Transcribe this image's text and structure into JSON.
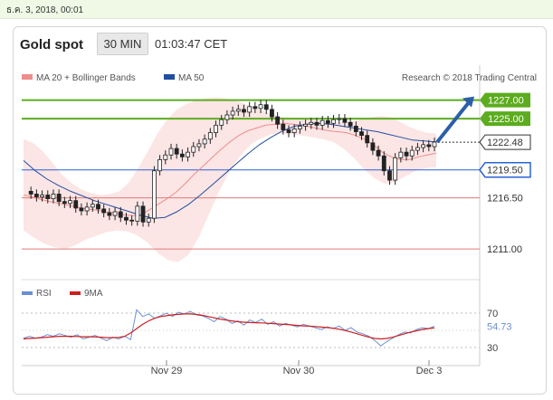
{
  "header": {
    "datetime": "ธ.ค. 3, 2018, 00:01",
    "title": "Gold spot",
    "timeframe": "30 MIN",
    "clock": "01:03:47 CET"
  },
  "chart_data": [
    {
      "type": "line",
      "title": "Gold spot",
      "legend": [
        {
          "name": "MA 20 + Bollinger Bands",
          "color": "#f08c8c"
        },
        {
          "name": "MA 50",
          "color": "#1f4fa0"
        }
      ],
      "credit": "Research © 2018 Trading Central",
      "x_ticks": [
        "Nov 29",
        "Nov 30",
        "Dec 3"
      ],
      "ylim": [
        1208,
        1229
      ],
      "price": [
        1217.2,
        1216.9,
        1216.6,
        1216.8,
        1216.4,
        1216.9,
        1216.1,
        1215.9,
        1216.2,
        1215.4,
        1215.1,
        1215.5,
        1215.8,
        1215.3,
        1214.9,
        1214.6,
        1215.0,
        1214.4,
        1214.1,
        1214.0,
        1215.6,
        1213.9,
        1214.3,
        1219.4,
        1220.6,
        1221.1,
        1221.8,
        1221.2,
        1220.9,
        1221.4,
        1222.0,
        1222.3,
        1222.8,
        1223.5,
        1224.3,
        1224.9,
        1225.4,
        1225.8,
        1226.0,
        1225.7,
        1226.3,
        1226.1,
        1226.5,
        1226.0,
        1225.2,
        1224.4,
        1223.8,
        1223.5,
        1223.9,
        1224.2,
        1224.4,
        1224.6,
        1224.3,
        1224.8,
        1224.5,
        1224.9,
        1225.0,
        1224.6,
        1224.2,
        1223.6,
        1223.2,
        1222.4,
        1221.6,
        1221.0,
        1219.4,
        1218.4,
        1220.8,
        1221.4,
        1221.0,
        1221.6,
        1221.9,
        1222.2,
        1222.0,
        1222.48
      ],
      "ma20": [
        1216.8,
        1216.6,
        1216.3,
        1216.1,
        1215.9,
        1215.7,
        1215.5,
        1215.3,
        1215.2,
        1215.0,
        1214.9,
        1214.7,
        1214.6,
        1214.6,
        1215.2,
        1215.8,
        1216.4,
        1217.1,
        1218.0,
        1219.0,
        1219.9,
        1220.8,
        1221.7,
        1222.5,
        1223.2,
        1223.7,
        1224.0,
        1224.3,
        1224.4,
        1224.5,
        1224.4,
        1224.3,
        1224.1,
        1223.9,
        1223.7,
        1223.6,
        1223.5,
        1223.2,
        1222.8,
        1222.2,
        1221.4,
        1220.9,
        1220.6,
        1220.6,
        1220.9,
        1221.1,
        1221.3
      ],
      "bb_upper": [
        1222.8,
        1222.4,
        1221.5,
        1220.3,
        1219.0,
        1218.1,
        1217.4,
        1217.0,
        1216.8,
        1216.9,
        1217.2,
        1218.2,
        1219.8,
        1221.6,
        1223.5,
        1225.0,
        1226.0,
        1226.6,
        1227.0,
        1227.2,
        1227.3,
        1227.2,
        1227.0,
        1226.6,
        1226.2,
        1225.8,
        1225.4,
        1225.2,
        1225.1,
        1225.0,
        1224.9,
        1224.8,
        1224.7,
        1224.6,
        1224.7,
        1224.9,
        1225.1,
        1225.3,
        1225.2,
        1224.8,
        1224.2,
        1223.8,
        1223.5,
        1223.4
      ],
      "bb_lower": [
        1213.0,
        1212.2,
        1211.6,
        1211.2,
        1211.0,
        1211.4,
        1212.0,
        1212.4,
        1212.8,
        1213.0,
        1212.9,
        1212.5,
        1211.7,
        1210.6,
        1209.8,
        1209.6,
        1210.4,
        1212.3,
        1214.8,
        1217.3,
        1219.4,
        1221.0,
        1222.2,
        1222.9,
        1223.3,
        1223.4,
        1223.3,
        1223.2,
        1223.0,
        1222.8,
        1222.5,
        1221.8,
        1220.8,
        1219.6,
        1218.6,
        1218.0,
        1218.2,
        1218.8,
        1219.4,
        1219.7,
        1219.8
      ],
      "ma50": [
        1220.5,
        1219.4,
        1218.5,
        1217.8,
        1217.2,
        1216.7,
        1216.2,
        1215.8,
        1215.4,
        1215.0,
        1214.6,
        1214.3,
        1214.4,
        1215.0,
        1215.8,
        1216.8,
        1217.9,
        1219.0,
        1220.1,
        1221.2,
        1222.2,
        1223.0,
        1223.7,
        1224.2,
        1224.4,
        1224.5,
        1224.4,
        1224.2,
        1224.0,
        1223.8,
        1223.6,
        1223.3,
        1223.0,
        1222.7,
        1222.6,
        1222.5
      ],
      "levels": [
        {
          "label": "1227.00",
          "value": 1227.0,
          "color": "#5cac1e",
          "style": "solid"
        },
        {
          "label": "1225.00",
          "value": 1225.0,
          "color": "#5cac1e",
          "style": "solid"
        },
        {
          "label": "1222.48",
          "value": 1222.48,
          "color": "#333333",
          "style": "dotted"
        },
        {
          "label": "1219.50",
          "value": 1219.5,
          "color": "#2a63d6",
          "style": "solid"
        },
        {
          "label": "1216.50",
          "value": 1216.5,
          "color": "#e07a7a",
          "style": "solid"
        },
        {
          "label": "1211.00",
          "value": 1211.0,
          "color": "#e07a7a",
          "style": "solid"
        }
      ],
      "forecast_arrow": {
        "from": 1222.48,
        "to": 1227.0
      }
    },
    {
      "type": "line",
      "title": "RSI",
      "legend": [
        {
          "name": "RSI",
          "color": "#6b8fd6"
        },
        {
          "name": "9MA",
          "color": "#cc1f1f"
        }
      ],
      "ylim": [
        20,
        80
      ],
      "y_ticks": [
        "70",
        "30"
      ],
      "current_label": "54.73",
      "rsi": [
        41,
        43,
        41,
        42,
        45,
        43,
        46,
        44,
        42,
        45,
        40,
        42,
        44,
        41,
        38,
        42,
        40,
        43,
        39,
        74,
        66,
        69,
        64,
        67,
        70,
        66,
        71,
        69,
        72,
        68,
        67,
        64,
        60,
        66,
        63,
        58,
        61,
        56,
        62,
        59,
        63,
        57,
        60,
        55,
        58,
        56,
        54,
        57,
        55,
        53,
        51,
        54,
        52,
        55,
        50,
        53,
        48,
        46,
        43,
        38,
        32,
        37,
        41,
        45,
        48,
        47,
        51,
        53,
        52,
        54.73
      ],
      "ma9": [
        40,
        40.5,
        41,
        41.5,
        42,
        42.5,
        43,
        43,
        43,
        42.8,
        42.5,
        42.5,
        42.3,
        42,
        41.5,
        41.5,
        41.8,
        43,
        47,
        52,
        57,
        61,
        64,
        66,
        67,
        68,
        68.5,
        69,
        69,
        68.5,
        67.5,
        66,
        64.5,
        63,
        62,
        61,
        60,
        59.5,
        59,
        58.8,
        58.6,
        58.2,
        57.8,
        57.3,
        56.8,
        56.3,
        55.7,
        55.2,
        54.8,
        54.4,
        53.8,
        53.2,
        52.4,
        51.3,
        49.8,
        48,
        46,
        44,
        42,
        40.5,
        40,
        40.5,
        42,
        44,
        46,
        48,
        49.5,
        51,
        52,
        52.8
      ]
    }
  ]
}
